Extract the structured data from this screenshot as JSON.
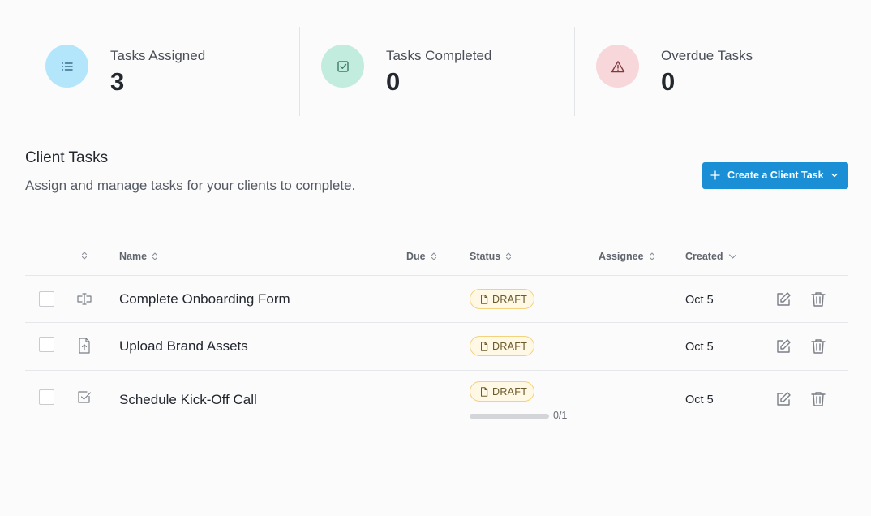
{
  "colors": {
    "accent": "#1a8fd6",
    "assigned_icon_bg": "#b3e6fb",
    "completed_icon_bg": "#c2ecde",
    "overdue_icon_bg": "#f8d7da",
    "draft_badge_bg": "#fff8e5",
    "draft_badge_border": "#f2d27c"
  },
  "stats": [
    {
      "label": "Tasks Assigned",
      "value": "3",
      "icon": "list-icon"
    },
    {
      "label": "Tasks Completed",
      "value": "0",
      "icon": "checkbox-icon"
    },
    {
      "label": "Overdue Tasks",
      "value": "0",
      "icon": "warning-icon"
    }
  ],
  "section": {
    "title": "Client Tasks",
    "subtitle": "Assign and manage tasks for your clients to complete.",
    "create_button": {
      "label": "Create a Client Task",
      "icon": "plus-icon",
      "caret": "chevron-down-icon"
    }
  },
  "table": {
    "columns": [
      {
        "key": "type",
        "label": ""
      },
      {
        "key": "name",
        "label": "Name"
      },
      {
        "key": "due",
        "label": "Due"
      },
      {
        "key": "status",
        "label": "Status"
      },
      {
        "key": "assignee",
        "label": "Assignee"
      },
      {
        "key": "created",
        "label": "Created"
      }
    ],
    "rows": [
      {
        "type_icon": "form-field-icon",
        "name": "Complete Onboarding Form",
        "due": "",
        "status": "DRAFT",
        "assignee": "",
        "created": "Oct 5"
      },
      {
        "type_icon": "file-upload-icon",
        "name": "Upload Brand Assets",
        "due": "",
        "status": "DRAFT",
        "assignee": "",
        "created": "Oct 5"
      },
      {
        "type_icon": "checkbox-icon",
        "name": "Schedule Kick-Off Call",
        "due": "",
        "status": "DRAFT",
        "assignee": "",
        "created": "Oct 5",
        "progress": {
          "text": "0/1",
          "completed": 0,
          "total": 1
        }
      }
    ]
  }
}
